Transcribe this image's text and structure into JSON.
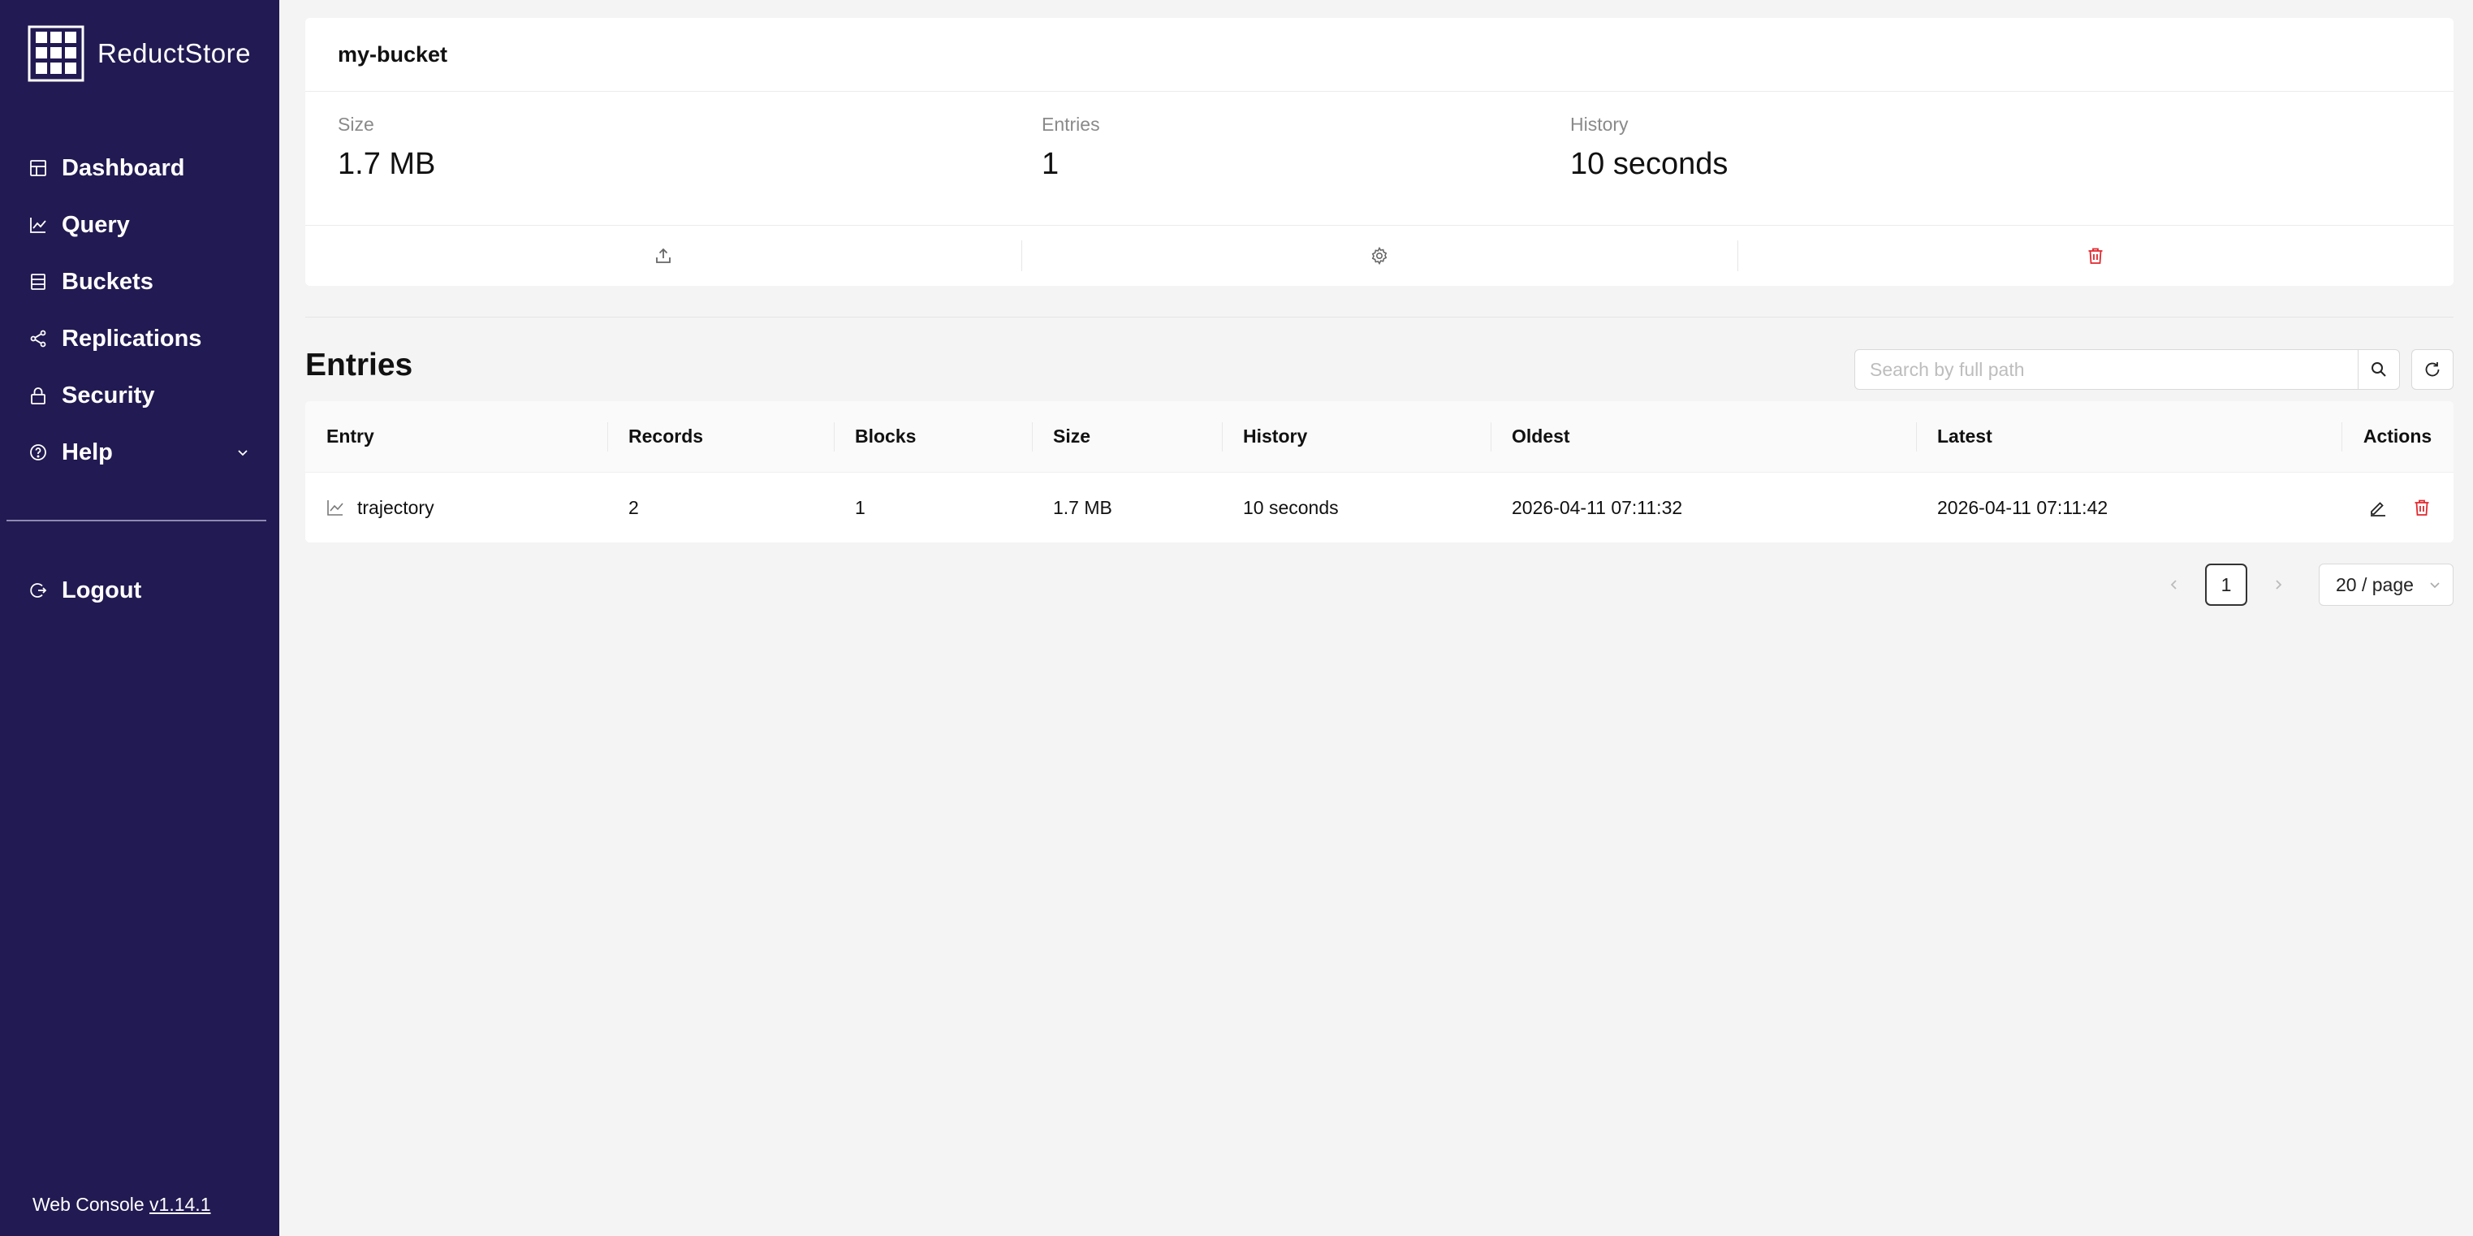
{
  "app": {
    "name": "ReductStore",
    "footer_prefix": "Web Console",
    "version": "v1.14.1"
  },
  "sidebar": {
    "items": [
      {
        "label": "Dashboard",
        "icon": "dashboard-icon"
      },
      {
        "label": "Query",
        "icon": "chart-line-icon"
      },
      {
        "label": "Buckets",
        "icon": "database-icon"
      },
      {
        "label": "Replications",
        "icon": "share-icon"
      },
      {
        "label": "Security",
        "icon": "lock-icon"
      },
      {
        "label": "Help",
        "icon": "question-circle-icon"
      }
    ],
    "logout_label": "Logout"
  },
  "bucket": {
    "name": "my-bucket",
    "stats": [
      {
        "label": "Size",
        "value": "1.7 MB"
      },
      {
        "label": "Entries",
        "value": "1"
      },
      {
        "label": "History",
        "value": "10 seconds"
      }
    ]
  },
  "entries": {
    "title": "Entries",
    "search_placeholder": "Search by full path",
    "columns": [
      "Entry",
      "Records",
      "Blocks",
      "Size",
      "History",
      "Oldest",
      "Latest",
      "Actions"
    ],
    "rows": [
      {
        "entry": "trajectory",
        "records": "2",
        "blocks": "1",
        "size": "1.7 MB",
        "history": "10 seconds",
        "oldest": "2026-04-11 07:11:32",
        "latest": "2026-04-11 07:11:42"
      }
    ]
  },
  "pagination": {
    "current_page": "1",
    "page_size": "20 / page"
  },
  "colors": {
    "sidebar_bg": "#221a52",
    "danger": "#e0282e",
    "background": "#f4f4f4"
  }
}
